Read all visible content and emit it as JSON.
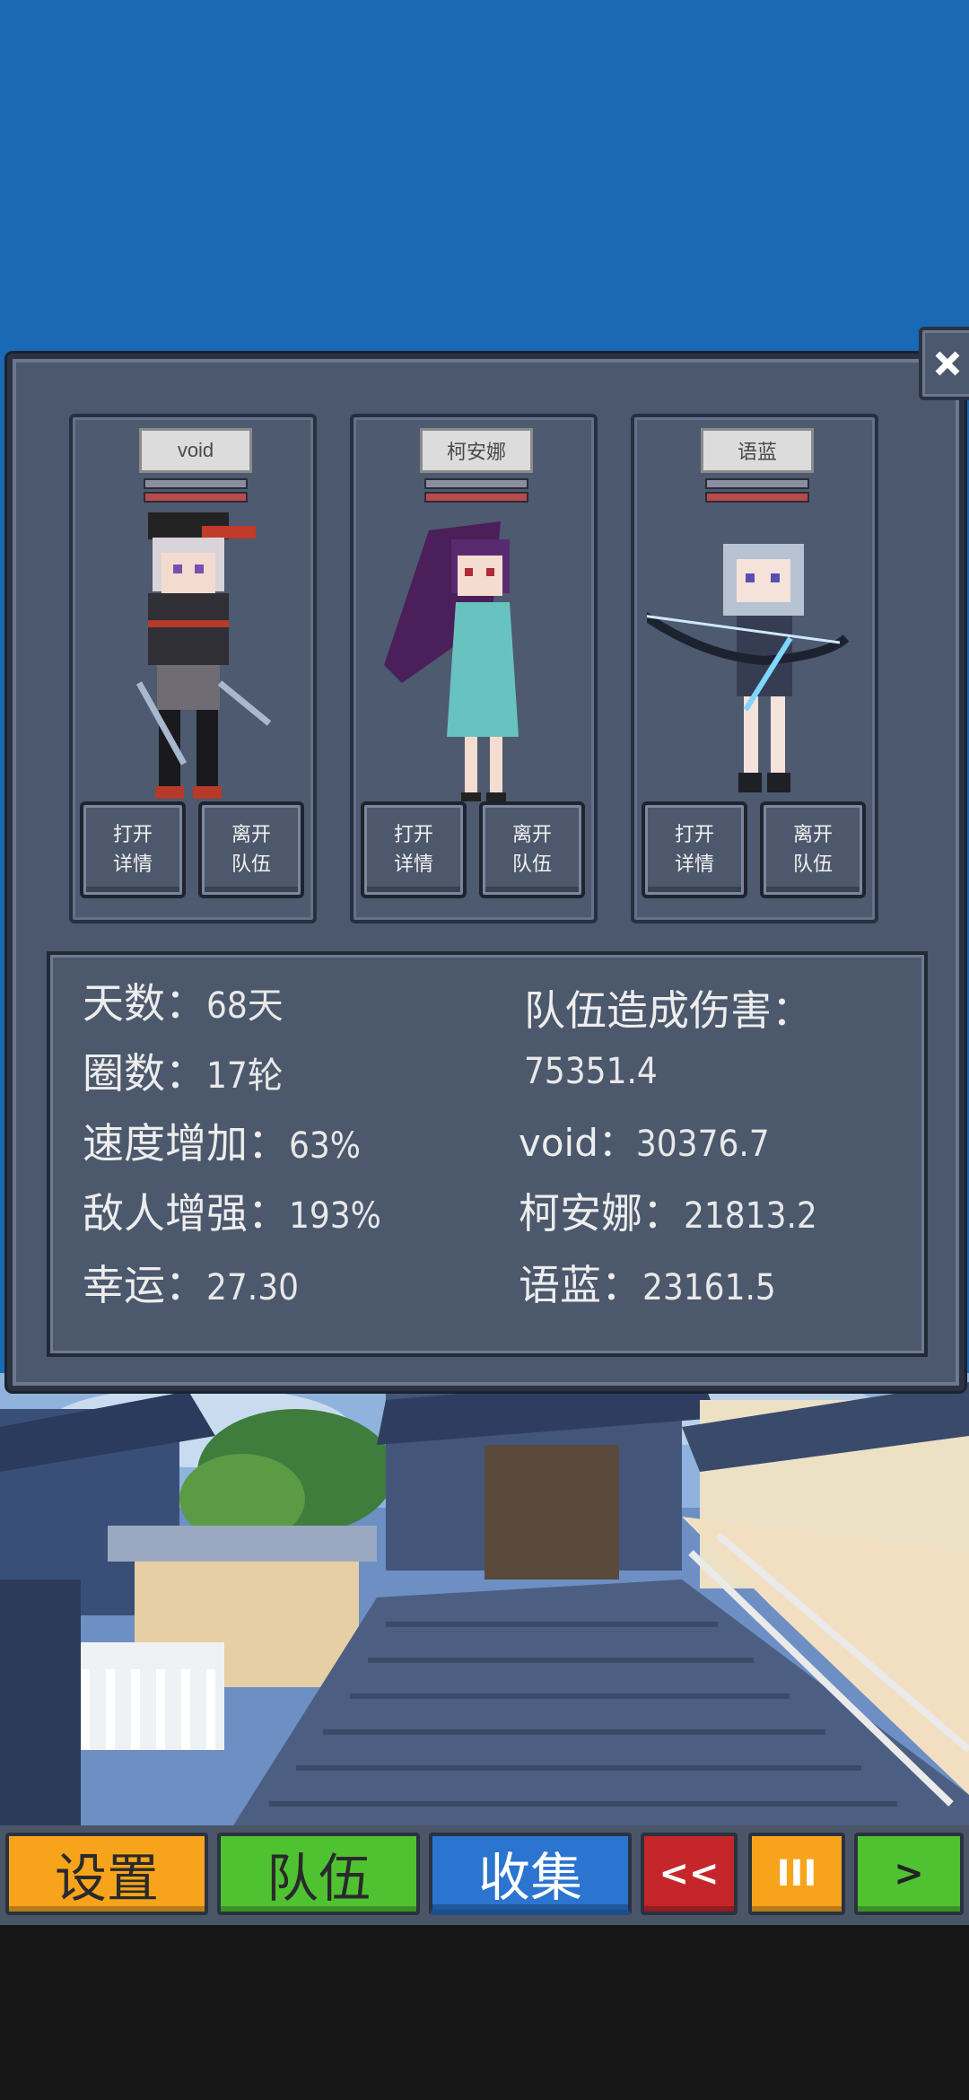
{
  "party": [
    {
      "name": "void",
      "detail_label": "打开\n详情",
      "leave_label": "离开\n队伍"
    },
    {
      "name": "柯安娜",
      "detail_label": "打开\n详情",
      "leave_label": "离开\n队伍"
    },
    {
      "name": "语蓝",
      "detail_label": "打开\n详情",
      "leave_label": "离开\n队伍"
    }
  ],
  "stats": {
    "days_label": "天数：",
    "days_value": "68天",
    "laps_label": "圈数：",
    "laps_value": "17轮",
    "speed_label": "速度增加：",
    "speed_value": "63%",
    "enemy_label": "敌人增强：",
    "enemy_value": "193%",
    "luck_label": "幸运：",
    "luck_value": "27.30",
    "damage_label": "队伍造成伤害：",
    "damage_value": "75351.4",
    "void_label": "void：",
    "void_value": "30376.7",
    "keana_label": "柯安娜：",
    "keana_value": "21813.2",
    "yulan_label": "语蓝：",
    "yulan_value": "23161.5"
  },
  "toolbar": {
    "settings": "设置",
    "team": "队伍",
    "collect": "收集",
    "rewind": "<<",
    "pause": "III",
    "play": ">"
  },
  "colors": {
    "sky": "#1969b5",
    "panel": "#4c586d",
    "orange": "#f7a41c",
    "green": "#4fc231",
    "blue": "#2b74cf",
    "red": "#c4262a"
  }
}
